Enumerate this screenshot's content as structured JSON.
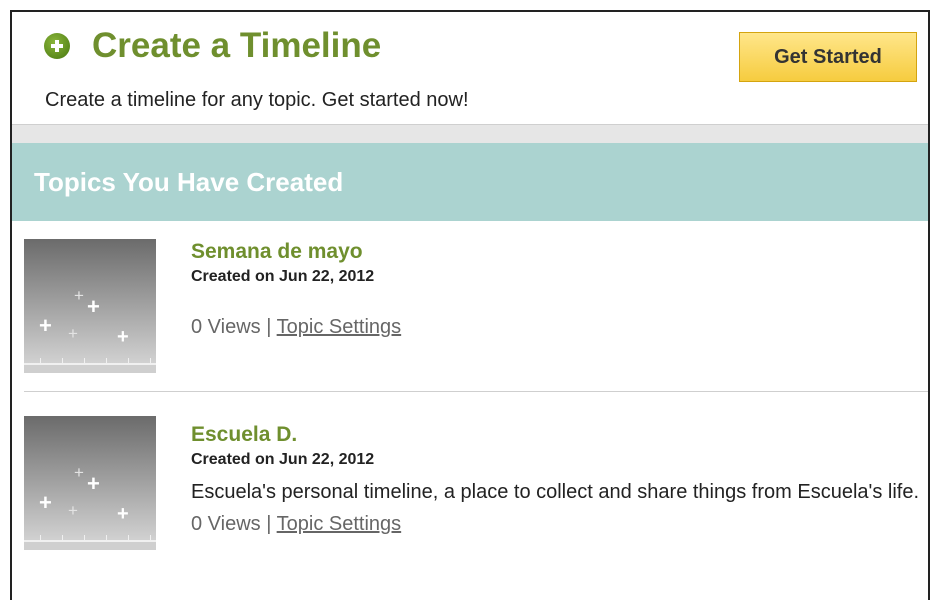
{
  "create_section": {
    "title": "Create a Timeline",
    "description": "Create a timeline for any topic. Get started now!",
    "button_label": "Get Started"
  },
  "topics_section": {
    "header": "Topics You Have Created",
    "topics": [
      {
        "title": "Semana de mayo",
        "created": "Created on Jun 22, 2012",
        "description": "",
        "views": "0 Views",
        "separator": "|",
        "settings_link": "Topic Settings"
      },
      {
        "title": "Escuela D.",
        "created": "Created on Jun 22, 2012",
        "description": "Escuela's personal timeline, a place to collect and share things from Escuela's life.",
        "views": "0 Views",
        "separator": "|",
        "settings_link": "Topic Settings"
      }
    ]
  },
  "colors": {
    "title_green": "#6f8f2e",
    "header_teal": "#abd3d0",
    "button_yellow": "#f6cc3f"
  },
  "icons": {
    "create": "plus-circle-icon",
    "thumbnail": "timeline-thumbnail"
  }
}
